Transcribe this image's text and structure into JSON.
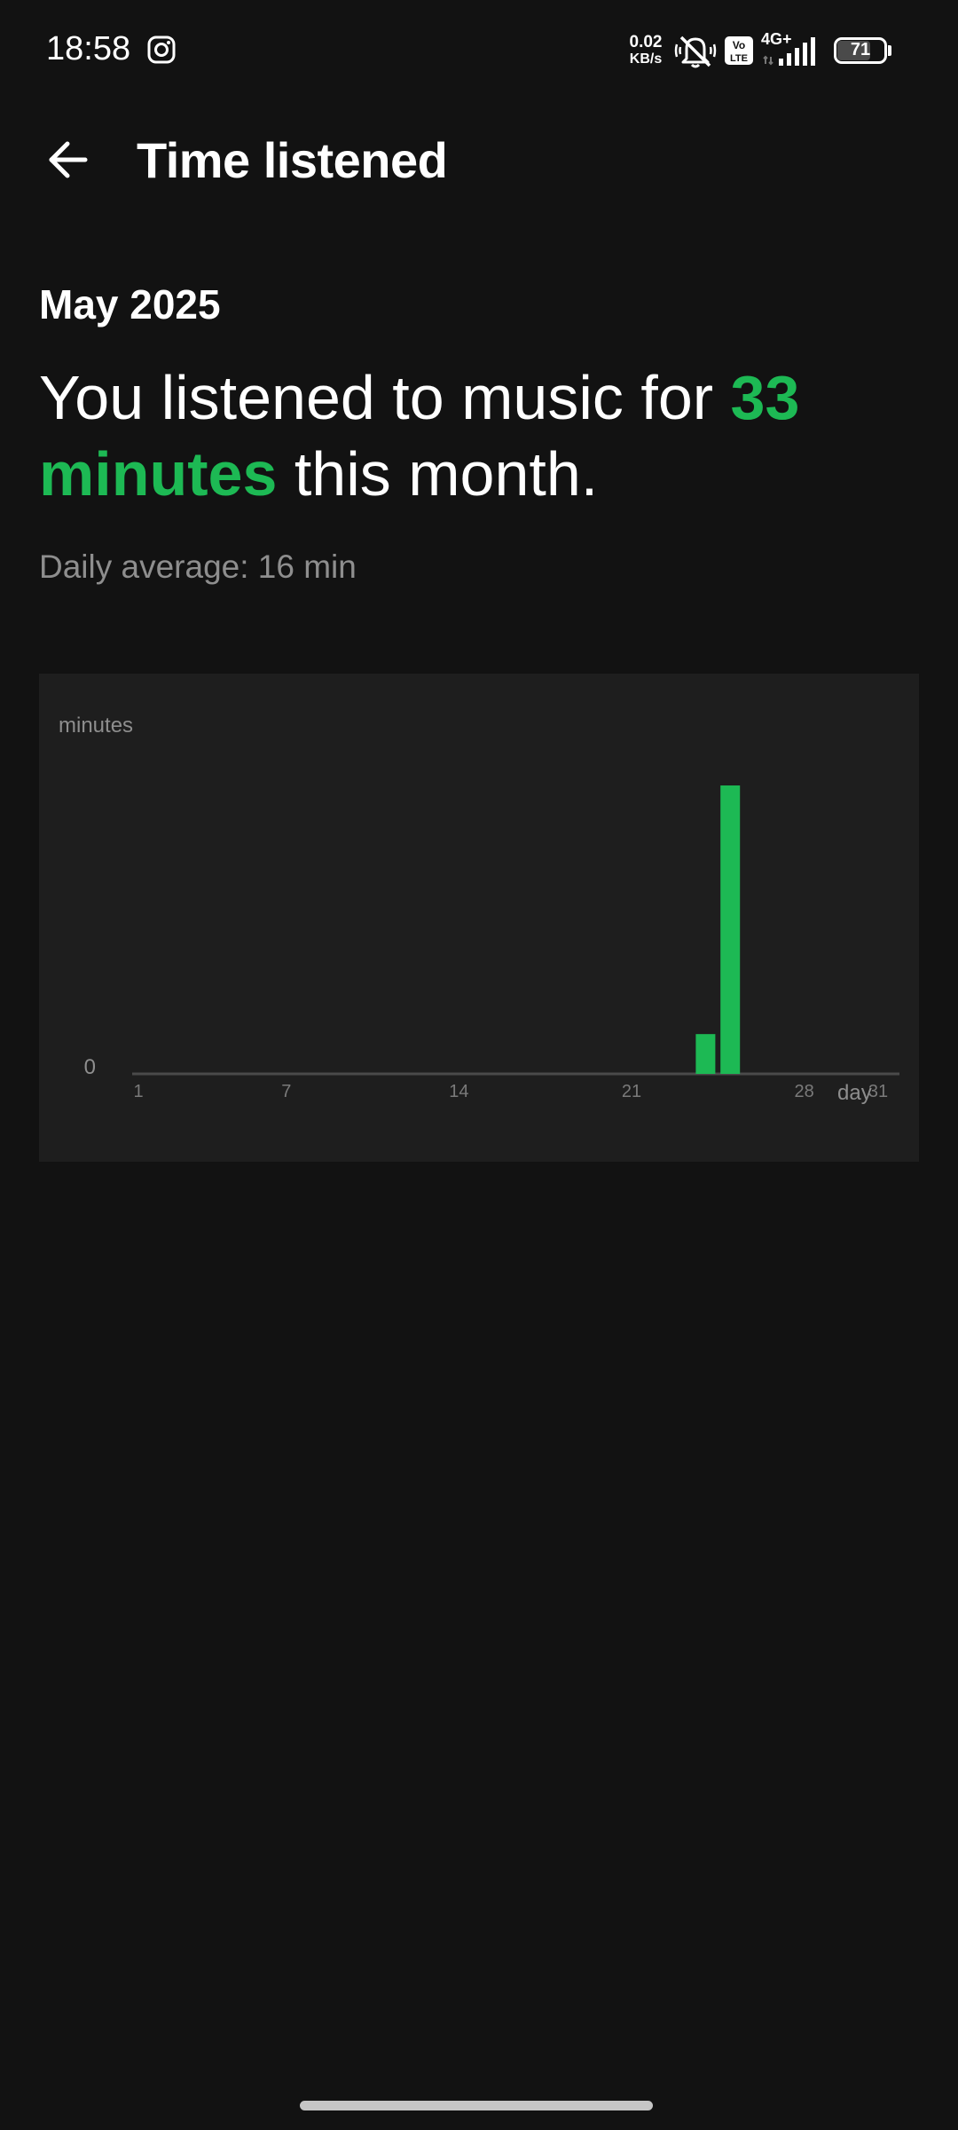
{
  "status_bar": {
    "time": "18:58",
    "net_speed_value": "0.02",
    "net_speed_unit": "KB/s",
    "network_label": "4G+",
    "volte_label": "Vo LTE",
    "battery_percent": "71",
    "battery_level": 0.71,
    "icons": [
      "instagram-icon",
      "mute-icon",
      "volte-icon",
      "signal-icon",
      "battery-icon"
    ]
  },
  "app_bar": {
    "title": "Time listened",
    "back_icon": "arrow-left-icon"
  },
  "summary": {
    "month": "May 2025",
    "headline_prefix": "You listened to music for ",
    "headline_highlight": "33 minutes",
    "headline_suffix": " this month.",
    "daily_average": "Daily average: 16 min"
  },
  "colors": {
    "background": "#121212",
    "card": "#1e1e1e",
    "accent": "#1db954",
    "muted_text": "#8e8e8e"
  },
  "chart_data": {
    "type": "bar",
    "ylabel": "minutes",
    "xlabel": "day",
    "y_tick_labels": [
      "0"
    ],
    "x_tick_labels": [
      "1",
      "7",
      "14",
      "21",
      "28",
      "31"
    ],
    "x_ticks": [
      1,
      7,
      14,
      21,
      28,
      31
    ],
    "xlim": [
      1,
      31
    ],
    "ylim": [
      0,
      31.5
    ],
    "grid": false,
    "color": "#1db954",
    "x": [
      24,
      25
    ],
    "values": [
      4,
      29
    ]
  }
}
